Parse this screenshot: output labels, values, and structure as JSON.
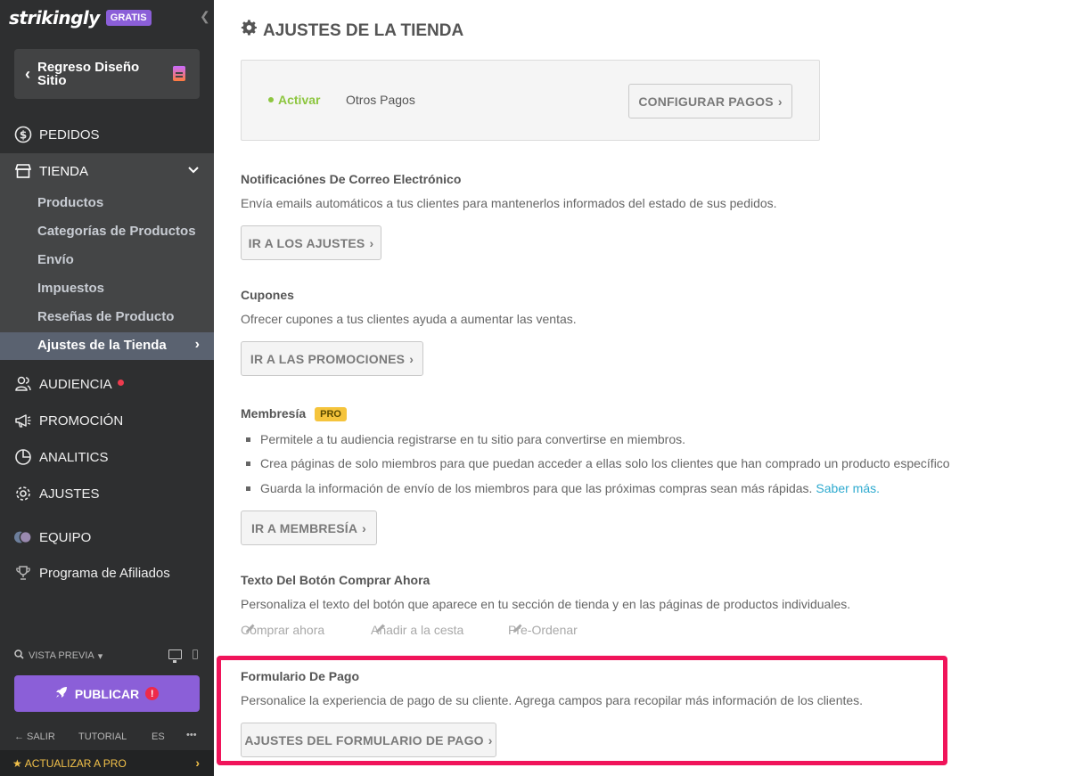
{
  "sidebar": {
    "logo": "strikingly",
    "plan_badge": "GRATIS",
    "back_button": "Regreso Diseño Sitio",
    "nav": {
      "pedidos": "PEDIDOS",
      "tienda": "TIENDA",
      "audiencia": "AUDIENCIA",
      "promocion": "PROMOCIÓN",
      "analitics": "ANALITICS",
      "ajustes": "AJUSTES",
      "equipo": "EQUIPO",
      "afiliados": "Programa de Afiliados"
    },
    "tienda_sub": [
      "Productos",
      "Categorías de Productos",
      "Envío",
      "Impuestos",
      "Reseñas de Producto",
      "Ajustes de la Tienda"
    ],
    "preview": "VISTA PREVIA",
    "publish": "PUBLICAR",
    "footer": {
      "exit": "SALIR",
      "tutorial": "TUTORIAL",
      "lang": "ES",
      "more": "•••"
    },
    "upgrade": "ACTUALIZAR A PRO"
  },
  "main": {
    "title": "AJUSTES DE LA TIENDA",
    "payments": {
      "status": "Activar",
      "name": "Otros Pagos",
      "button": "CONFIGURAR PAGOS"
    },
    "notifications": {
      "title": "Notificaciónes De Correo Electrónico",
      "desc": "Envía emails automáticos a tus clientes para mantenerlos informados del estado de sus pedidos.",
      "button": "IR A LOS AJUSTES"
    },
    "coupons": {
      "title": "Cupones",
      "desc": "Ofrecer cupones a tus clientes ayuda a aumentar las ventas.",
      "button": "IR A LAS PROMOCIONES"
    },
    "membership": {
      "title": "Membresía",
      "badge": "PRO",
      "bullets": [
        "Permitele a tu audiencia registrarse en tu sitio para convertirse en miembros.",
        "Crea páginas de solo miembros para que puedan acceder a ellas solo los clientes que han comprado un producto específico",
        "Guarda la información de envío de los miembros para que las próximas compras sean más rápidas."
      ],
      "link": "Saber más.",
      "button": "IR A MEMBRESÍA"
    },
    "buy_button": {
      "title": "Texto Del Botón Comprar Ahora",
      "desc": "Personaliza el texto del botón que aparece en tu sección de tienda y en las páginas de productos individuales.",
      "options": [
        "Comprar ahora",
        "Añadir a la cesta",
        "Pre-Ordenar"
      ]
    },
    "checkout_form": {
      "title": "Formulario De Pago",
      "desc": "Personalice la experiencia de pago de su cliente. Agrega campos para recopilar más información de los clientes.",
      "button": "AJUSTES DEL FORMULARIO DE PAGO"
    }
  }
}
